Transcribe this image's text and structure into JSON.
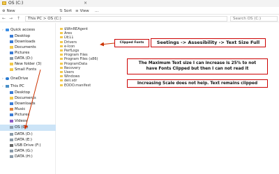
{
  "titlebar": {
    "tab": "OS (C:)",
    "tab_close": "×"
  },
  "commandbar": {
    "new": "New",
    "sort": "Sort",
    "view": "View",
    "more": "..."
  },
  "addressbar": {
    "path": "This PC  >  OS (C:)",
    "search_placeholder": "Search OS (C:)",
    "back": "←",
    "forward": "→",
    "up": "↑"
  },
  "nav": {
    "items": [
      {
        "label": "Quick access",
        "icon": "star"
      },
      {
        "label": "Desktop",
        "icon": "blue"
      },
      {
        "label": "Downloads",
        "icon": "blue"
      },
      {
        "label": "Documents",
        "icon": "folder"
      },
      {
        "label": "Pictures",
        "icon": "blue"
      },
      {
        "label": "DATA (D:)",
        "icon": "drive"
      },
      {
        "label": "New folder (3)",
        "icon": "folder"
      },
      {
        "label": "Small Fonts",
        "icon": "folder"
      },
      {
        "label": "OneDrive",
        "icon": "cloud"
      },
      {
        "label": "This PC",
        "icon": "pc"
      },
      {
        "label": "Desktop",
        "icon": "blue"
      },
      {
        "label": "Documents",
        "icon": "folder"
      },
      {
        "label": "Downloads",
        "icon": "blue"
      },
      {
        "label": "Music",
        "icon": "music"
      },
      {
        "label": "Pictures",
        "icon": "blue"
      },
      {
        "label": "Videos",
        "icon": "video"
      },
      {
        "label": "OS (C:)",
        "icon": "drive"
      },
      {
        "label": "DATA (D:)",
        "icon": "drive"
      },
      {
        "label": "DATA (E:)",
        "icon": "drive"
      },
      {
        "label": "USB Drive (F:)",
        "icon": "usb"
      },
      {
        "label": "DATA (G:)",
        "icon": "drive"
      },
      {
        "label": "DATA (H:)",
        "icon": "drive"
      }
    ]
  },
  "files": [
    "$WinREAgent",
    "Ares",
    "DE11",
    "Drivers",
    "e-Icon",
    "PerfLogs",
    "Program Files",
    "Program Files (x86)",
    "ProgramData",
    "Recovery",
    "Users",
    "Windows",
    "dell.sdr",
    "EODO.manifest"
  ],
  "annotations": {
    "clipped": "Clipped Fonts",
    "settings": "Seetings -> Assesibility -> Text Size Full",
    "max_line1": "The Maximum Text size I can increase is 25% to not",
    "max_line2": "have Fonts Clipped but then I can not read it",
    "scale": "Increasing Scale does not help. Text remains clipped"
  },
  "colors": {
    "annotation_border": "#cc0000",
    "arrow": "#cc3300",
    "selection": "#cce4f7"
  }
}
